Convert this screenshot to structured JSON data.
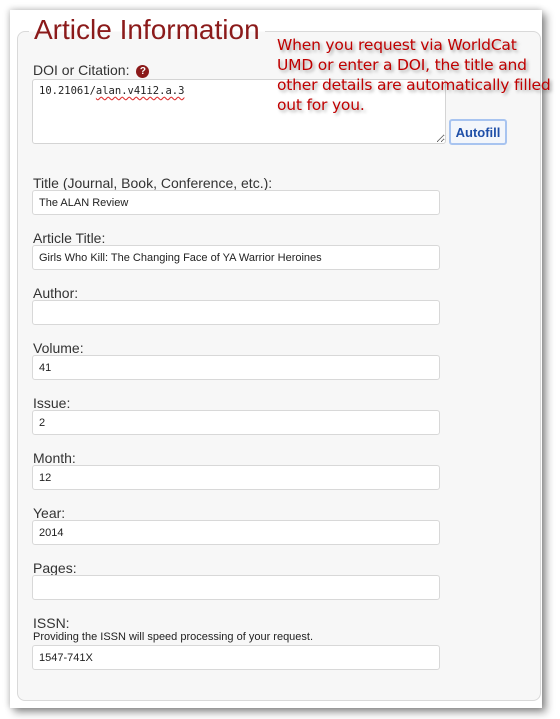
{
  "section": {
    "title": "Article Information"
  },
  "callout": {
    "text": "When you request via WorldCat UMD or enter a DOI, the title and other details are automatically filled out for you."
  },
  "doi": {
    "label": "DOI or Citation:",
    "help_icon": "question-circle-icon",
    "help_glyph": "?",
    "value_prefix": "10.21061/",
    "value_suffix": "alan.v41i2.a.3",
    "value": "10.21061/alan.v41i2.a.3",
    "autofill_label": "Autofill"
  },
  "fields": [
    {
      "label": "Title (Journal, Book, Conference, etc.):",
      "value": ""
    },
    {
      "label": "Article Title:",
      "value": ""
    },
    {
      "label": "Author:",
      "value": ""
    },
    {
      "label": "Volume:",
      "value": ""
    },
    {
      "label": "Issue:",
      "value": ""
    },
    {
      "label": "Month:",
      "value": ""
    },
    {
      "label": "Year:",
      "value": ""
    },
    {
      "label": "Pages:",
      "value": ""
    },
    {
      "label": "ISSN:",
      "value": ""
    }
  ],
  "values": {
    "title": "The ALAN Review",
    "article_title": "Girls Who Kill: The Changing Face of YA Warrior Heroines",
    "author": "",
    "volume": "41",
    "issue": "2",
    "month": "12",
    "year": "2014",
    "pages": "",
    "issn": "1547-741X"
  },
  "issn_hint": "Providing the ISSN will speed processing of your request."
}
